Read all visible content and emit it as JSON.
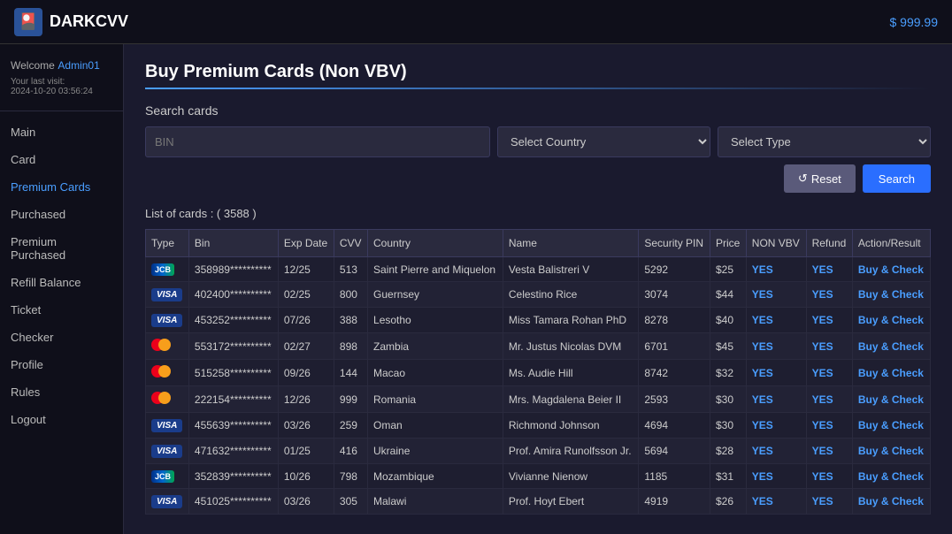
{
  "navbar": {
    "brand": "DARKCVV",
    "balance": "$ 999.99"
  },
  "sidebar": {
    "welcome": "Welcome",
    "username": "Admin01",
    "last_visit_label": "Your last visit:",
    "last_visit_date": "2024-10-20 03:56:24",
    "nav": [
      {
        "label": "Main",
        "href": "#",
        "active": false
      },
      {
        "label": "Card",
        "href": "#",
        "active": false
      },
      {
        "label": "Premium Cards",
        "href": "#",
        "active": true
      },
      {
        "label": "Purchased",
        "href": "#",
        "active": false
      },
      {
        "label": "Premium Purchased",
        "href": "#",
        "active": false
      },
      {
        "label": "Refill Balance",
        "href": "#",
        "active": false
      },
      {
        "label": "Ticket",
        "href": "#",
        "active": false
      },
      {
        "label": "Checker",
        "href": "#",
        "active": false
      },
      {
        "label": "Profile",
        "href": "#",
        "active": false
      },
      {
        "label": "Rules",
        "href": "#",
        "active": false
      },
      {
        "label": "Logout",
        "href": "#",
        "active": false
      }
    ]
  },
  "page": {
    "title": "Buy Premium Cards (Non VBV)",
    "search_section": "Search cards",
    "bin_placeholder": "BIN",
    "country_placeholder": "Select Country",
    "type_placeholder": "Select Type",
    "reset_button": "Reset",
    "search_button": "Search",
    "list_info": "List of cards : ( 3588 )",
    "table_headers": [
      "Type",
      "Bin",
      "Exp Date",
      "CVV",
      "Country",
      "Name",
      "Security PIN",
      "Price",
      "NON VBV",
      "Refund",
      "Action/Result"
    ],
    "cards": [
      {
        "type": "jcb",
        "bin": "358989**********",
        "exp": "12/25",
        "cvv": "513",
        "country": "Saint Pierre and Miquelon",
        "name": "Vesta Balistreri V",
        "pin": "5292",
        "price": "$25",
        "nonvbv": "YES",
        "refund": "YES"
      },
      {
        "type": "visa",
        "bin": "402400**********",
        "exp": "02/25",
        "cvv": "800",
        "country": "Guernsey",
        "name": "Celestino Rice",
        "pin": "3074",
        "price": "$44",
        "nonvbv": "YES",
        "refund": "YES"
      },
      {
        "type": "visa",
        "bin": "453252**********",
        "exp": "07/26",
        "cvv": "388",
        "country": "Lesotho",
        "name": "Miss Tamara Rohan PhD",
        "pin": "8278",
        "price": "$40",
        "nonvbv": "YES",
        "refund": "YES"
      },
      {
        "type": "mc",
        "bin": "553172**********",
        "exp": "02/27",
        "cvv": "898",
        "country": "Zambia",
        "name": "Mr. Justus Nicolas DVM",
        "pin": "6701",
        "price": "$45",
        "nonvbv": "YES",
        "refund": "YES"
      },
      {
        "type": "mc",
        "bin": "515258**********",
        "exp": "09/26",
        "cvv": "144",
        "country": "Macao",
        "name": "Ms. Audie Hill",
        "pin": "8742",
        "price": "$32",
        "nonvbv": "YES",
        "refund": "YES"
      },
      {
        "type": "mc",
        "bin": "222154**********",
        "exp": "12/26",
        "cvv": "999",
        "country": "Romania",
        "name": "Mrs. Magdalena Beier II",
        "pin": "2593",
        "price": "$30",
        "nonvbv": "YES",
        "refund": "YES"
      },
      {
        "type": "visa",
        "bin": "455639**********",
        "exp": "03/26",
        "cvv": "259",
        "country": "Oman",
        "name": "Richmond Johnson",
        "pin": "4694",
        "price": "$30",
        "nonvbv": "YES",
        "refund": "YES"
      },
      {
        "type": "visa",
        "bin": "471632**********",
        "exp": "01/25",
        "cvv": "416",
        "country": "Ukraine",
        "name": "Prof. Amira Runolfsson Jr.",
        "pin": "5694",
        "price": "$28",
        "nonvbv": "YES",
        "refund": "YES"
      },
      {
        "type": "jcb",
        "bin": "352839**********",
        "exp": "10/26",
        "cvv": "798",
        "country": "Mozambique",
        "name": "Vivianne Nienow",
        "pin": "1185",
        "price": "$31",
        "nonvbv": "YES",
        "refund": "YES"
      },
      {
        "type": "visa",
        "bin": "451025**********",
        "exp": "03/26",
        "cvv": "305",
        "country": "Malawi",
        "name": "Prof. Hoyt Ebert",
        "pin": "4919",
        "price": "$26",
        "nonvbv": "YES",
        "refund": "YES"
      }
    ],
    "action_label": "Buy & Check"
  }
}
